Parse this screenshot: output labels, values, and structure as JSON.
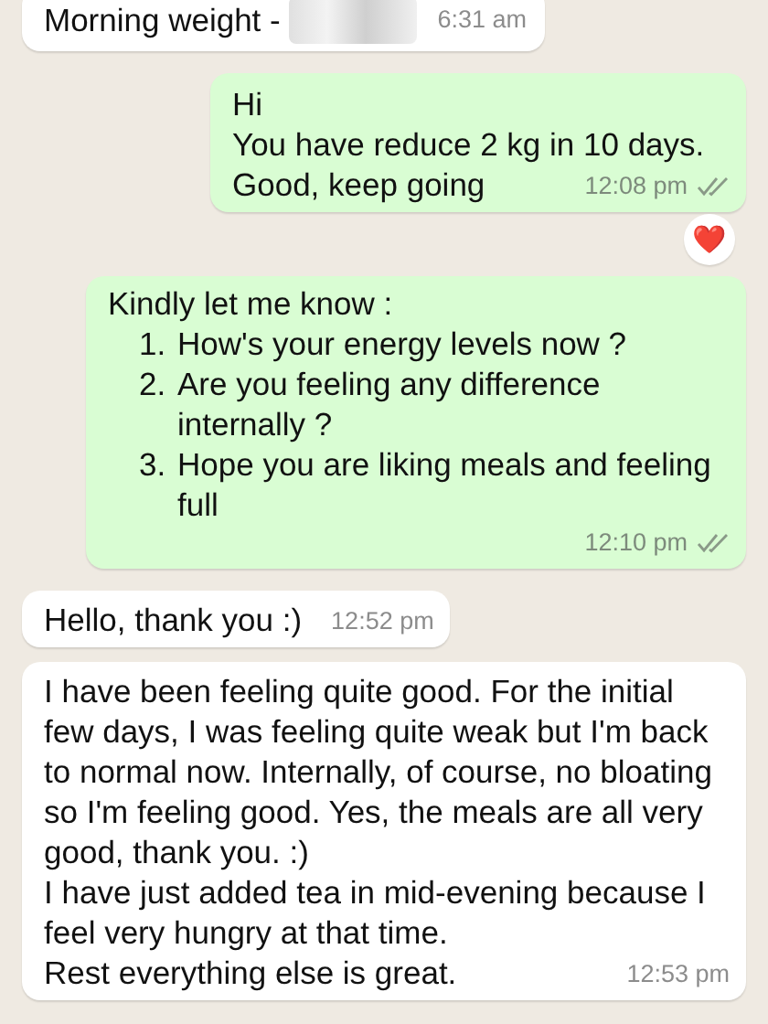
{
  "messages": [
    {
      "kind": "text",
      "outgoing": false,
      "lines": [
        "Morning weight - "
      ],
      "redacted": true,
      "time": "6:31 am"
    },
    {
      "kind": "text",
      "outgoing": true,
      "lines": [
        "Hi",
        "You have reduce 2 kg in 10 days.",
        "Good, keep going"
      ],
      "time": "12:08 pm",
      "read": false,
      "reaction": "❤️"
    },
    {
      "kind": "list",
      "outgoing": true,
      "intro": "Kindly let me know :",
      "items": [
        {
          "number": "1.",
          "text": "How's your energy levels now ?"
        },
        {
          "number": "2.",
          "text": "Are you feeling any difference internally ?"
        },
        {
          "number": "3.",
          "text": "Hope you are liking meals and feeling full"
        }
      ],
      "time": "12:10 pm",
      "read": false
    },
    {
      "kind": "text",
      "outgoing": false,
      "lines": [
        "Hello, thank you :)"
      ],
      "time": "12:52 pm"
    },
    {
      "kind": "text",
      "outgoing": false,
      "lines": [
        "I have been feeling quite good. For the initial few days, I was feeling quite weak but I'm back to normal now. Internally, of course, no bloating so I'm feeling good. Yes, the meals are all very good, thank you. :)",
        "I have just added tea in mid-evening because I feel very hungry at that time.",
        "Rest everything else is great."
      ],
      "time": "12:53 pm"
    }
  ]
}
